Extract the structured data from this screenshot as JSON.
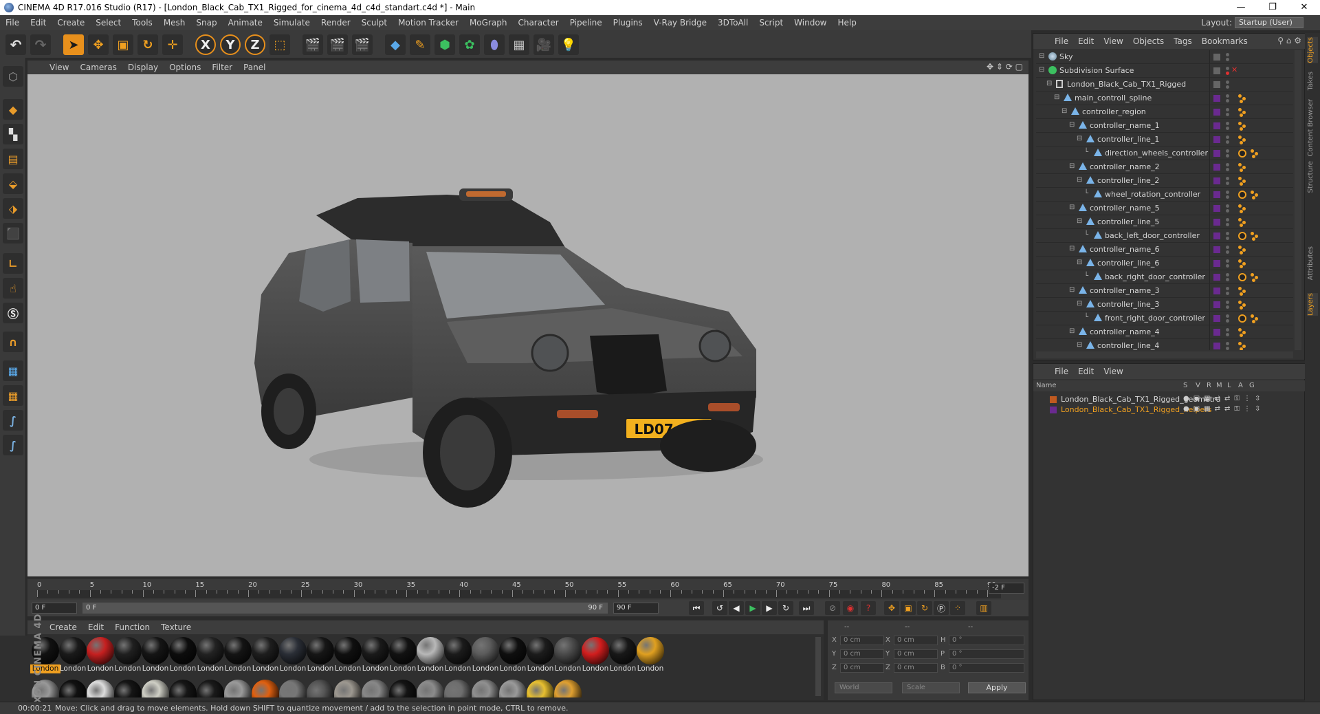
{
  "window": {
    "title": "CINEMA 4D R17.016 Studio (R17) - [London_Black_Cab_TX1_Rigged_for_cinema_4d_c4d_standart.c4d *] - Main",
    "minimize": "—",
    "maximize": "❐",
    "close": "✕"
  },
  "menubar": {
    "items": [
      "File",
      "Edit",
      "Create",
      "Select",
      "Tools",
      "Mesh",
      "Snap",
      "Animate",
      "Simulate",
      "Render",
      "Sculpt",
      "Motion Tracker",
      "MoGraph",
      "Character",
      "Pipeline",
      "Plugins",
      "V-Ray Bridge",
      "3DToAll",
      "Script",
      "Window",
      "Help"
    ],
    "layout_label": "Layout:",
    "layout_value": "Startup (User)"
  },
  "toolbar": {
    "axis_x": "X",
    "axis_y": "Y",
    "axis_z": "Z"
  },
  "viewport": {
    "menu": [
      "View",
      "Cameras",
      "Display",
      "Options",
      "Filter",
      "Panel"
    ],
    "plate": "LD07 CCJ",
    "colors": {
      "background": "#b1b1b1",
      "car_body": "#4b4b4b",
      "plate": "#f2b01e"
    }
  },
  "timeline": {
    "ticks": [
      "0",
      "5",
      "10",
      "15",
      "20",
      "25",
      "30",
      "35",
      "40",
      "45",
      "50",
      "55",
      "60",
      "65",
      "70",
      "75",
      "80",
      "85",
      "90"
    ],
    "current": "-2 F",
    "start": "0 F",
    "range_start": "0 F",
    "range_end": "90 F",
    "end": "90 F"
  },
  "materials": {
    "menu": [
      "Create",
      "Edit",
      "Function",
      "Texture"
    ],
    "row1": [
      {
        "label": "London",
        "color": "#111111",
        "selected": true
      },
      {
        "label": "London",
        "color": "#1a1a1a"
      },
      {
        "label": "London",
        "color": "#c62020"
      },
      {
        "label": "London",
        "color": "#202020"
      },
      {
        "label": "London",
        "color": "#151515"
      },
      {
        "label": "London",
        "color": "#0d0d0d"
      },
      {
        "label": "London",
        "color": "#222222"
      },
      {
        "label": "London",
        "color": "#141414"
      },
      {
        "label": "London",
        "color": "#1e1e1e"
      },
      {
        "label": "London",
        "color": "#2a2e36"
      },
      {
        "label": "London",
        "color": "#161616"
      },
      {
        "label": "London",
        "color": "#101010"
      },
      {
        "label": "London",
        "color": "#1a1a1a"
      },
      {
        "label": "London",
        "color": "#121212"
      },
      {
        "label": "London",
        "color": "#b8b8b8"
      },
      {
        "label": "London",
        "color": "#1b1b1b"
      },
      {
        "label": "London",
        "color": "#5b5b5b"
      },
      {
        "label": "London",
        "color": "#0f0f0f"
      },
      {
        "label": "London",
        "color": "#1c1c1c"
      },
      {
        "label": "London",
        "color": "#4a4a4a"
      },
      {
        "label": "London",
        "color": "#d21e1e"
      },
      {
        "label": "London",
        "color": "#181818"
      },
      {
        "label": "London",
        "color": "#e0a020"
      }
    ],
    "row2": [
      "#999999",
      "#111111",
      "#dddddd",
      "#151515",
      "#cfcfc5",
      "#161616",
      "#1a1a1a",
      "#9a9a9a",
      "#e06010",
      "#777777",
      "#555555",
      "#9d9890",
      "#888888",
      "#141414",
      "#8c8c8c",
      "#6e6e6e",
      "#909090",
      "#9a9a9a",
      "#e8c030",
      "#e0a030"
    ]
  },
  "coords": {
    "headers": [
      "--",
      "--",
      "--"
    ],
    "rows": [
      {
        "a": "X",
        "av": "0 cm",
        "b": "X",
        "bv": "0 cm",
        "c": "H",
        "cv": "0 °"
      },
      {
        "a": "Y",
        "av": "0 cm",
        "b": "Y",
        "bv": "0 cm",
        "c": "P",
        "cv": "0 °"
      },
      {
        "a": "Z",
        "av": "0 cm",
        "b": "Z",
        "bv": "0 cm",
        "c": "B",
        "cv": "0 °"
      }
    ],
    "world": "World",
    "scale": "Scale",
    "apply": "Apply"
  },
  "status": {
    "time": "00:00:21",
    "message": "Move: Click and drag to move elements. Hold down SHIFT to quantize movement / add to the selection in point mode, CTRL to remove."
  },
  "objects": {
    "menu": [
      "File",
      "Edit",
      "View",
      "Objects",
      "Tags",
      "Bookmarks"
    ],
    "tree": [
      {
        "name": "Sky",
        "depth": 0,
        "icon": "sky",
        "tag": "none"
      },
      {
        "name": "Subdivision Surface",
        "depth": 0,
        "icon": "subdiv",
        "tag": "none"
      },
      {
        "name": "London_Black_Cab_TX1_Rigged",
        "depth": 1,
        "icon": "null",
        "tag": "none"
      },
      {
        "name": "main_controll_spline",
        "depth": 2,
        "icon": "spline",
        "tag": "dots"
      },
      {
        "name": "controller_region",
        "depth": 3,
        "icon": "spline",
        "tag": "dots"
      },
      {
        "name": "controller_name_1",
        "depth": 4,
        "icon": "spline",
        "tag": "dots"
      },
      {
        "name": "controller_line_1",
        "depth": 5,
        "icon": "spline",
        "tag": "dots"
      },
      {
        "name": "direction_wheels_controller",
        "depth": 6,
        "icon": "spline",
        "tag": "protect"
      },
      {
        "name": "controller_name_2",
        "depth": 4,
        "icon": "spline",
        "tag": "dots"
      },
      {
        "name": "controller_line_2",
        "depth": 5,
        "icon": "spline",
        "tag": "dots"
      },
      {
        "name": "wheel_rotation_controller",
        "depth": 6,
        "icon": "spline",
        "tag": "protect"
      },
      {
        "name": "controller_name_5",
        "depth": 4,
        "icon": "spline",
        "tag": "dots"
      },
      {
        "name": "controller_line_5",
        "depth": 5,
        "icon": "spline",
        "tag": "dots"
      },
      {
        "name": "back_left_door_controller",
        "depth": 6,
        "icon": "spline",
        "tag": "protect"
      },
      {
        "name": "controller_name_6",
        "depth": 4,
        "icon": "spline",
        "tag": "dots"
      },
      {
        "name": "controller_line_6",
        "depth": 5,
        "icon": "spline",
        "tag": "dots"
      },
      {
        "name": "back_right_door_controller",
        "depth": 6,
        "icon": "spline",
        "tag": "protect"
      },
      {
        "name": "controller_name_3",
        "depth": 4,
        "icon": "spline",
        "tag": "dots"
      },
      {
        "name": "controller_line_3",
        "depth": 5,
        "icon": "spline",
        "tag": "dots"
      },
      {
        "name": "front_right_door_controller",
        "depth": 6,
        "icon": "spline",
        "tag": "protect"
      },
      {
        "name": "controller_name_4",
        "depth": 4,
        "icon": "spline",
        "tag": "dots"
      },
      {
        "name": "controller_line_4",
        "depth": 5,
        "icon": "spline",
        "tag": "dots"
      }
    ]
  },
  "layers": {
    "menu": [
      "File",
      "Edit",
      "View"
    ],
    "columns": [
      "Name",
      "S",
      "V",
      "R",
      "M",
      "L",
      "A",
      "G"
    ],
    "rows": [
      {
        "name": "London_Black_Cab_TX1_Rigged_geometru",
        "color": "#c05a20",
        "text_color": "#d6d6d6"
      },
      {
        "name": "London_Black_Cab_TX1_Rigged_helpers",
        "color": "#6a2a90",
        "text_color": "#f0a020"
      }
    ]
  },
  "right_tabs": [
    "Objects",
    "Takes",
    "Content Browser",
    "Structure",
    "Attributes",
    "Layers"
  ]
}
